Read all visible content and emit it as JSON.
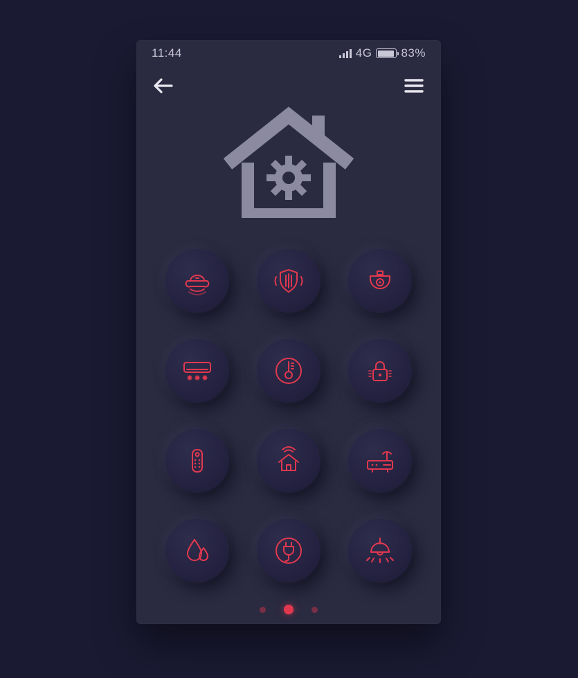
{
  "status": {
    "time": "11:44",
    "network": "4G",
    "battery_pct": "83%"
  },
  "colors": {
    "accent": "#e2384f",
    "bg_page": "#1a1a33",
    "bg_phone": "#2a2a40",
    "text_muted": "#c9c6d6",
    "hero": "#8b8aa0"
  },
  "grid": {
    "items": [
      {
        "name": "robot-vacuum-icon"
      },
      {
        "name": "security-shield-icon"
      },
      {
        "name": "cctv-camera-icon"
      },
      {
        "name": "ac-unit-icon"
      },
      {
        "name": "thermometer-icon"
      },
      {
        "name": "lock-icon"
      },
      {
        "name": "remote-control-icon"
      },
      {
        "name": "smart-home-icon"
      },
      {
        "name": "router-icon"
      },
      {
        "name": "water-drop-icon"
      },
      {
        "name": "power-plug-icon"
      },
      {
        "name": "ceiling-light-icon"
      }
    ]
  },
  "pager": {
    "count": 3,
    "active_index": 1
  }
}
